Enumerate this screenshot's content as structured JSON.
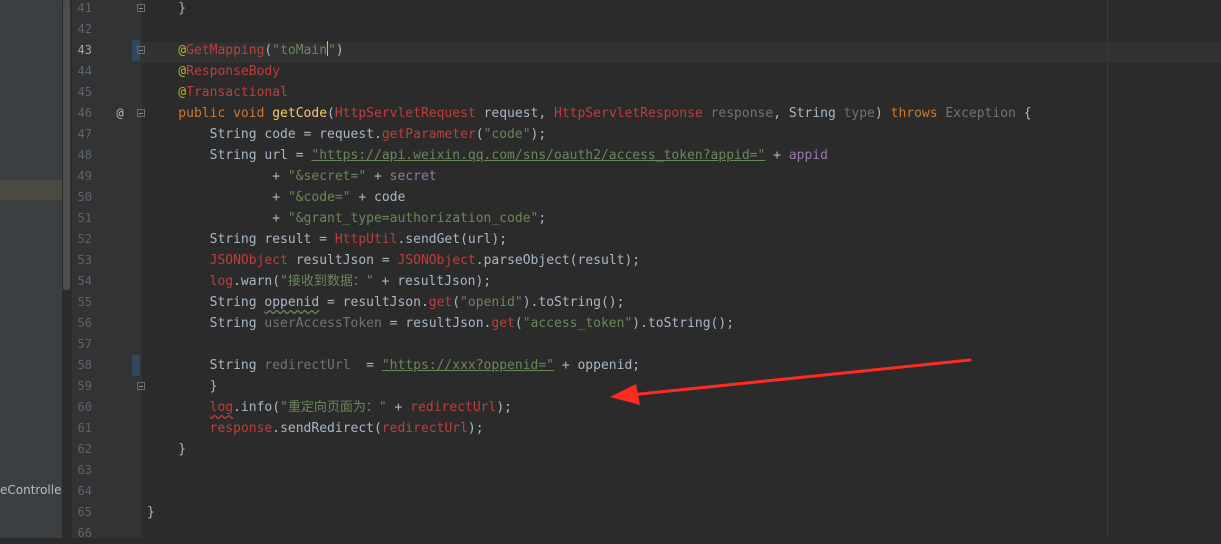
{
  "sidebar": {
    "visible_label": "eController"
  },
  "gutter": {
    "override_icon": "@"
  },
  "annotation": {
    "icon": "red-arrow-icon",
    "color": "#ff2b20"
  },
  "colors": {
    "background": "#2b2b2b",
    "keyword": "#cc7832",
    "annotation": "#bbb529",
    "string": "#6a8759",
    "error": "#bc3f3c"
  },
  "editor": {
    "lines": [
      {
        "n": "41",
        "tokens": [
          {
            "t": "    }",
            "c": ""
          }
        ]
      },
      {
        "n": "42",
        "tokens": []
      },
      {
        "n": "43",
        "tokens": [
          {
            "t": "    @",
            "c": "t-ann"
          },
          {
            "t": "GetMapping",
            "c": "t-err"
          },
          {
            "t": "(",
            "c": ""
          },
          {
            "t": "\"toMain\"",
            "c": "t-str"
          },
          {
            "t": ")",
            "c": ""
          }
        ]
      },
      {
        "n": "44",
        "tokens": [
          {
            "t": "    @",
            "c": "t-ann"
          },
          {
            "t": "ResponseBody",
            "c": "t-err"
          }
        ]
      },
      {
        "n": "45",
        "tokens": [
          {
            "t": "    @",
            "c": "t-ann"
          },
          {
            "t": "Transactional",
            "c": "t-err"
          }
        ]
      },
      {
        "n": "46",
        "tokens": [
          {
            "t": "    public void ",
            "c": "t-kw"
          },
          {
            "t": "getCode",
            "c": "t-fn"
          },
          {
            "t": "(",
            "c": ""
          },
          {
            "t": "HttpServletRequest",
            "c": "t-err"
          },
          {
            "t": " request, ",
            "c": ""
          },
          {
            "t": "HttpServletResponse",
            "c": "t-err"
          },
          {
            "t": " ",
            "c": ""
          },
          {
            "t": "response",
            "c": "t-gray"
          },
          {
            "t": ", String ",
            "c": ""
          },
          {
            "t": "type",
            "c": "t-gray"
          },
          {
            "t": ") ",
            "c": ""
          },
          {
            "t": "throws",
            "c": "t-kw"
          },
          {
            "t": " ",
            "c": ""
          },
          {
            "t": "Exception",
            "c": "t-gray"
          },
          {
            "t": " {",
            "c": ""
          }
        ]
      },
      {
        "n": "47",
        "tokens": [
          {
            "t": "        String code = request.",
            "c": ""
          },
          {
            "t": "getParameter",
            "c": "t-err"
          },
          {
            "t": "(",
            "c": ""
          },
          {
            "t": "\"code\"",
            "c": "t-str"
          },
          {
            "t": ");",
            "c": ""
          }
        ]
      },
      {
        "n": "48",
        "tokens": [
          {
            "t": "        String url = ",
            "c": ""
          },
          {
            "t": "\"https://api.weixin.qq.com/sns/oauth2/access_token?appid=\"",
            "c": "t-str t-link"
          },
          {
            "t": " + ",
            "c": ""
          },
          {
            "t": "appid",
            "c": "t-var"
          }
        ]
      },
      {
        "n": "49",
        "tokens": [
          {
            "t": "                + ",
            "c": ""
          },
          {
            "t": "\"&secret=\"",
            "c": "t-str"
          },
          {
            "t": " + ",
            "c": ""
          },
          {
            "t": "secret",
            "c": "t-var"
          }
        ]
      },
      {
        "n": "50",
        "tokens": [
          {
            "t": "                + ",
            "c": ""
          },
          {
            "t": "\"&code=\"",
            "c": "t-str"
          },
          {
            "t": " + code",
            "c": ""
          }
        ]
      },
      {
        "n": "51",
        "tokens": [
          {
            "t": "                + ",
            "c": ""
          },
          {
            "t": "\"&grant_type=authorization_code\"",
            "c": "t-str"
          },
          {
            "t": ";",
            "c": ""
          }
        ]
      },
      {
        "n": "52",
        "tokens": [
          {
            "t": "        String result = ",
            "c": ""
          },
          {
            "t": "HttpUtil",
            "c": "t-err"
          },
          {
            "t": ".sendGet(url);",
            "c": ""
          }
        ]
      },
      {
        "n": "53",
        "tokens": [
          {
            "t": "        ",
            "c": ""
          },
          {
            "t": "JSONObject",
            "c": "t-err"
          },
          {
            "t": " resultJson = ",
            "c": ""
          },
          {
            "t": "JSONObject",
            "c": "t-err"
          },
          {
            "t": ".parseObject(result);",
            "c": ""
          }
        ]
      },
      {
        "n": "54",
        "tokens": [
          {
            "t": "        ",
            "c": ""
          },
          {
            "t": "log",
            "c": "t-err"
          },
          {
            "t": ".warn(",
            "c": ""
          },
          {
            "t": "\"接收到数据：\"",
            "c": "t-str"
          },
          {
            "t": " + resultJson);",
            "c": ""
          }
        ]
      },
      {
        "n": "55",
        "tokens": [
          {
            "t": "        String ",
            "c": ""
          },
          {
            "t": "oppenid",
            "c": "t-squig"
          },
          {
            "t": " = resultJson.",
            "c": ""
          },
          {
            "t": "get",
            "c": "t-err"
          },
          {
            "t": "(",
            "c": ""
          },
          {
            "t": "\"openid\"",
            "c": "t-str"
          },
          {
            "t": ").toString();",
            "c": ""
          }
        ]
      },
      {
        "n": "56",
        "tokens": [
          {
            "t": "        String ",
            "c": ""
          },
          {
            "t": "userAccessToken",
            "c": "t-gray"
          },
          {
            "t": " = resultJson.",
            "c": ""
          },
          {
            "t": "get",
            "c": "t-err"
          },
          {
            "t": "(",
            "c": ""
          },
          {
            "t": "\"access_token\"",
            "c": "t-str"
          },
          {
            "t": ").toString();",
            "c": ""
          }
        ]
      },
      {
        "n": "57",
        "tokens": []
      },
      {
        "n": "58",
        "tokens": [
          {
            "t": "        String ",
            "c": ""
          },
          {
            "t": "redirectUrl",
            "c": "t-gray"
          },
          {
            "t": "  = ",
            "c": ""
          },
          {
            "t": "\"https://xxx?oppenid=\"",
            "c": "t-str t-link"
          },
          {
            "t": " + oppenid;",
            "c": ""
          }
        ]
      },
      {
        "n": "59",
        "tokens": [
          {
            "t": "        }",
            "c": ""
          }
        ]
      },
      {
        "n": "60",
        "tokens": [
          {
            "t": "        ",
            "c": ""
          },
          {
            "t": "log",
            "c": "t-err t-squig-red"
          },
          {
            "t": ".info(",
            "c": ""
          },
          {
            "t": "\"重定向页面为：\"",
            "c": "t-str"
          },
          {
            "t": " + ",
            "c": ""
          },
          {
            "t": "redirectUrl",
            "c": "t-err"
          },
          {
            "t": ");",
            "c": ""
          }
        ]
      },
      {
        "n": "61",
        "tokens": [
          {
            "t": "        ",
            "c": ""
          },
          {
            "t": "response",
            "c": "t-err"
          },
          {
            "t": ".sendRedirect(",
            "c": ""
          },
          {
            "t": "redirectUrl",
            "c": "t-err"
          },
          {
            "t": ");",
            "c": ""
          }
        ]
      },
      {
        "n": "62",
        "tokens": [
          {
            "t": "    }",
            "c": ""
          }
        ]
      },
      {
        "n": "63",
        "tokens": []
      },
      {
        "n": "64",
        "tokens": []
      },
      {
        "n": "65",
        "tokens": [
          {
            "t": "}",
            "c": ""
          }
        ]
      },
      {
        "n": "66",
        "tokens": []
      }
    ]
  }
}
